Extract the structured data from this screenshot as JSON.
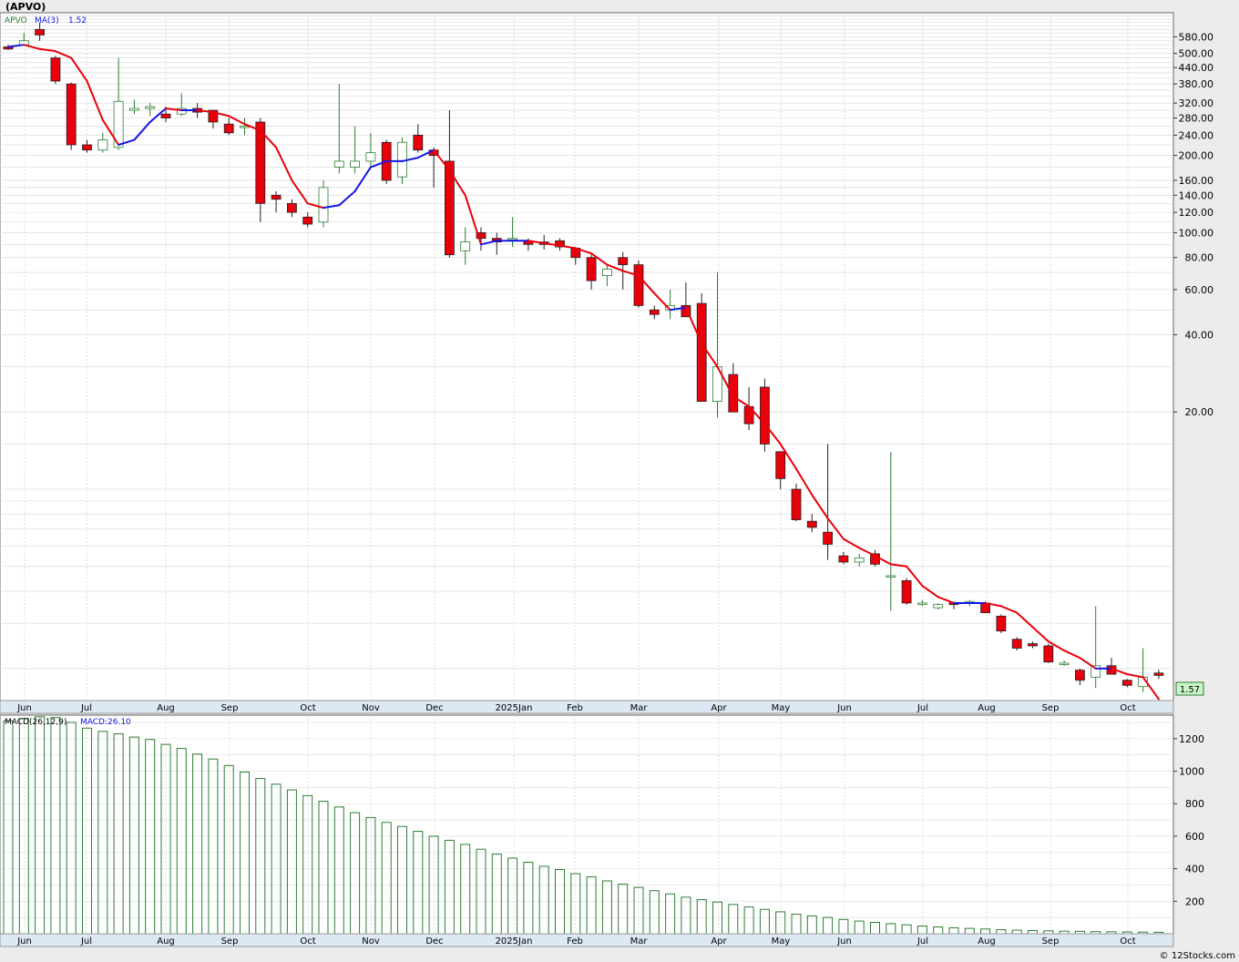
{
  "header": {
    "title": "(APVO)"
  },
  "footer": {
    "credit": "© 12Stocks.com"
  },
  "price_panel": {
    "legend_symbol": "APVO",
    "legend_ma": "MA(3)",
    "legend_ma_value": "1.52",
    "last_price": "1.57",
    "y_ticks": [
      "580.00",
      "500.00",
      "440.00",
      "380.00",
      "320.00",
      "280.00",
      "240.00",
      "200.00",
      "160.00",
      "140.00",
      "120.00",
      "100.00",
      "80.00",
      "60.00",
      "40.00",
      "20.00"
    ]
  },
  "macd_panel": {
    "legend_label": "MACD(26,12,9)",
    "legend_value": "MACD:26.10",
    "y_ticks": [
      "1200",
      "1000",
      "800",
      "600",
      "400",
      "200"
    ]
  },
  "x_labels": [
    "Jun",
    "Jul",
    "Aug",
    "Sep",
    "Oct",
    "Nov",
    "Dec",
    "2025Jan",
    "Feb",
    "Mar",
    "Apr",
    "May",
    "Jun",
    "Jul",
    "Aug",
    "Sep",
    "Oct"
  ],
  "colors": {
    "up_body": "#ffffff",
    "up_wick": "#2e7d32",
    "down_body": "#e8000b",
    "ma_up": "#1515e6",
    "ma_down": "#e8000b",
    "macd_bar": "#2e7d32",
    "last_price_bg": "#c8f5c8"
  },
  "chart_data": [
    {
      "type": "candlestick",
      "title": "(APVO)",
      "scale": "log",
      "interval": "weekly",
      "x_labels": [
        "Jun",
        "Jul",
        "Aug",
        "Sep",
        "Oct",
        "Nov",
        "Dec",
        "2025Jan",
        "Feb",
        "Mar",
        "Apr",
        "May",
        "Jun",
        "Jul",
        "Aug",
        "Sep",
        "Oct"
      ],
      "ohlc": [
        [
          530,
          540,
          515,
          520
        ],
        [
          540,
          600,
          535,
          560
        ],
        [
          620,
          660,
          560,
          590
        ],
        [
          480,
          490,
          380,
          390
        ],
        [
          380,
          385,
          210,
          220
        ],
        [
          220,
          230,
          205,
          210
        ],
        [
          210,
          245,
          205,
          230
        ],
        [
          215,
          480,
          210,
          325
        ],
        [
          300,
          330,
          290,
          305
        ],
        [
          305,
          320,
          285,
          310
        ],
        [
          290,
          310,
          270,
          280
        ],
        [
          290,
          350,
          285,
          305
        ],
        [
          305,
          320,
          280,
          295
        ],
        [
          300,
          300,
          255,
          270
        ],
        [
          265,
          280,
          240,
          245
        ],
        [
          260,
          280,
          240,
          260
        ],
        [
          270,
          280,
          110,
          130
        ],
        [
          140,
          145,
          120,
          135
        ],
        [
          130,
          135,
          115,
          120
        ],
        [
          115,
          120,
          105,
          108
        ],
        [
          110,
          160,
          105,
          150
        ],
        [
          180,
          380,
          170,
          190
        ],
        [
          180,
          260,
          170,
          190
        ],
        [
          190,
          245,
          180,
          205
        ],
        [
          225,
          230,
          155,
          160
        ],
        [
          165,
          235,
          155,
          225
        ],
        [
          240,
          265,
          205,
          210
        ],
        [
          210,
          215,
          150,
          200
        ],
        [
          190,
          300,
          80,
          82
        ],
        [
          85,
          105,
          75,
          92
        ],
        [
          100,
          105,
          85,
          95
        ],
        [
          95,
          100,
          82,
          92
        ],
        [
          95,
          115,
          88,
          95
        ],
        [
          93,
          95,
          85,
          90
        ],
        [
          92,
          98,
          86,
          90
        ],
        [
          93,
          95,
          85,
          88
        ],
        [
          87,
          88,
          75,
          80
        ],
        [
          80,
          82,
          60,
          65
        ],
        [
          68,
          75,
          62,
          72
        ],
        [
          80,
          84,
          60,
          75
        ],
        [
          75,
          78,
          51,
          52
        ],
        [
          50,
          52,
          46,
          48
        ],
        [
          50,
          60,
          46,
          52
        ],
        [
          52,
          64,
          48,
          47
        ],
        [
          53,
          58,
          22,
          22
        ],
        [
          22,
          70,
          19,
          30
        ],
        [
          28,
          31,
          20,
          20
        ],
        [
          21,
          25,
          17,
          18
        ],
        [
          25,
          27,
          14,
          15
        ],
        [
          14,
          14,
          10,
          11
        ],
        [
          10,
          10.5,
          7.5,
          7.6
        ],
        [
          7.5,
          8,
          6.8,
          7.1
        ],
        [
          6.8,
          15,
          5.3,
          6.1
        ],
        [
          5.5,
          5.7,
          5.1,
          5.2
        ],
        [
          5.2,
          5.6,
          5.0,
          5.4
        ],
        [
          5.6,
          5.8,
          5.0,
          5.1
        ],
        [
          4.6,
          14,
          3.35,
          4.6
        ],
        [
          4.4,
          4.5,
          3.55,
          3.6
        ],
        [
          3.6,
          3.7,
          3.5,
          3.6
        ],
        [
          3.45,
          3.6,
          3.4,
          3.55
        ],
        [
          3.6,
          3.65,
          3.4,
          3.55
        ],
        [
          3.6,
          3.7,
          3.5,
          3.65
        ],
        [
          3.6,
          3.65,
          3.3,
          3.3
        ],
        [
          3.2,
          3.25,
          2.75,
          2.8
        ],
        [
          2.6,
          2.65,
          2.35,
          2.4
        ],
        [
          2.5,
          2.55,
          2.4,
          2.45
        ],
        [
          2.45,
          2.5,
          2.1,
          2.12
        ],
        [
          2.1,
          2.15,
          2.05,
          2.1
        ],
        [
          1.97,
          2.0,
          1.72,
          1.8
        ],
        [
          1.85,
          3.5,
          1.68,
          2.05
        ],
        [
          2.05,
          2.2,
          1.9,
          1.9
        ],
        [
          1.8,
          1.82,
          1.69,
          1.72
        ],
        [
          1.7,
          2.4,
          1.62,
          1.85
        ],
        [
          1.92,
          1.98,
          1.82,
          1.88
        ]
      ],
      "ma3": [
        530,
        540,
        520,
        510,
        480,
        390,
        275,
        220,
        230,
        270,
        305,
        300,
        300,
        295,
        285,
        265,
        250,
        215,
        160,
        130,
        125,
        128,
        145,
        180,
        190,
        190,
        196,
        210,
        175,
        140,
        90,
        93,
        93,
        93,
        91,
        89,
        87,
        83,
        75,
        71,
        68,
        58,
        50,
        51,
        37,
        30,
        23,
        21,
        18,
        15,
        12,
        9.5,
        7.7,
        6.4,
        5.9,
        5.5,
        5.1,
        5.0,
        4.2,
        3.8,
        3.6,
        3.6,
        3.6,
        3.5,
        3.3,
        2.9,
        2.55,
        2.35,
        2.2,
        2.0,
        2.0,
        1.9,
        1.85,
        1.52
      ],
      "ylim": [
        1.5,
        720
      ]
    },
    {
      "type": "bar",
      "title": "MACD(26,12,9)",
      "last_value": 26.1,
      "values": [
        1310,
        1325,
        1335,
        1330,
        1300,
        1265,
        1245,
        1230,
        1210,
        1195,
        1165,
        1140,
        1105,
        1075,
        1035,
        995,
        955,
        920,
        885,
        850,
        815,
        780,
        745,
        715,
        685,
        660,
        630,
        600,
        575,
        550,
        520,
        490,
        465,
        440,
        415,
        395,
        370,
        350,
        325,
        305,
        285,
        265,
        245,
        225,
        210,
        195,
        180,
        165,
        150,
        135,
        120,
        110,
        100,
        88,
        78,
        70,
        62,
        55,
        48,
        42,
        37,
        33,
        29,
        25,
        22,
        20,
        18,
        16,
        15,
        13,
        12,
        11,
        10,
        9
      ],
      "ylim": [
        0,
        1345
      ]
    }
  ]
}
